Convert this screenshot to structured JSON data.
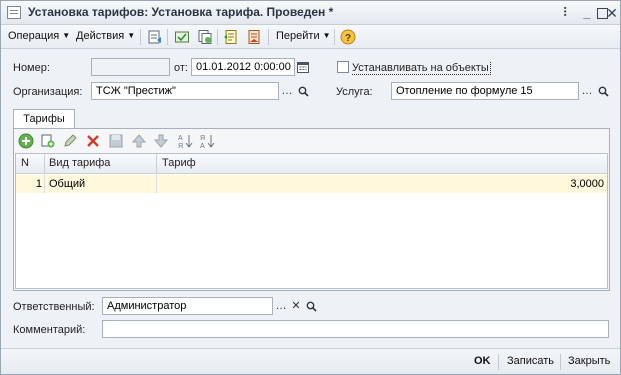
{
  "window": {
    "title": "Установка тарифов: Установка тарифа. Проведен *"
  },
  "toolbar": {
    "operation_label": "Операция",
    "actions_label": "Действия",
    "goto_label": "Перейти"
  },
  "form": {
    "number_label": "Номер:",
    "number_value": "",
    "date_label": "от:",
    "date_value": "01.01.2012  0:00:00",
    "set_on_objects_label": "Устанавливать на объекты",
    "set_on_objects_checked": false,
    "organization_label": "Организация:",
    "organization_value": "ТСЖ \"Престиж\"",
    "service_label": "Услуга:",
    "service_value": "Отопление по формуле 15",
    "responsible_label": "Ответственный:",
    "responsible_value": "Администратор",
    "comment_label": "Комментарий:",
    "comment_value": ""
  },
  "tabs": [
    {
      "label": "Тарифы"
    }
  ],
  "tariff_table": {
    "headers": {
      "n": "N",
      "type": "Вид тарифа",
      "tariff": "Тариф"
    },
    "rows": [
      {
        "n": "1",
        "type": "Общий",
        "tariff": "3,0000"
      }
    ]
  },
  "footer": {
    "ok_label": "OK",
    "write_label": "Записать",
    "close_label": "Закрыть"
  },
  "colors": {
    "selected_row": "#fff8dc",
    "title_text": "#2b3540"
  }
}
